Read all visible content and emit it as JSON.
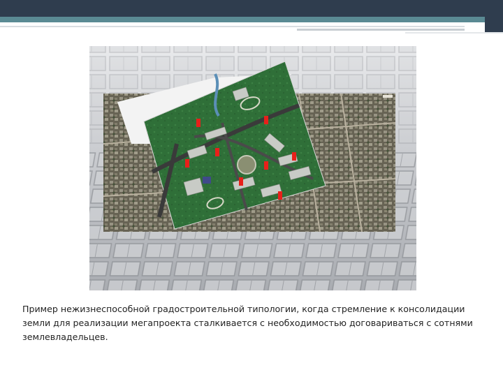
{
  "slide": {
    "caption": "Пример нежизнеспособной градостроительной типологии, когда стремление к консолидации земли для реализации мегапроекта сталкивается с необходимостью договариваться с сотнями землевладельцев.",
    "colors": {
      "header": "#2f3d4e",
      "accent": "#5a8a93",
      "plan_green": "#2f6f38",
      "markers": "#e8201a"
    }
  }
}
